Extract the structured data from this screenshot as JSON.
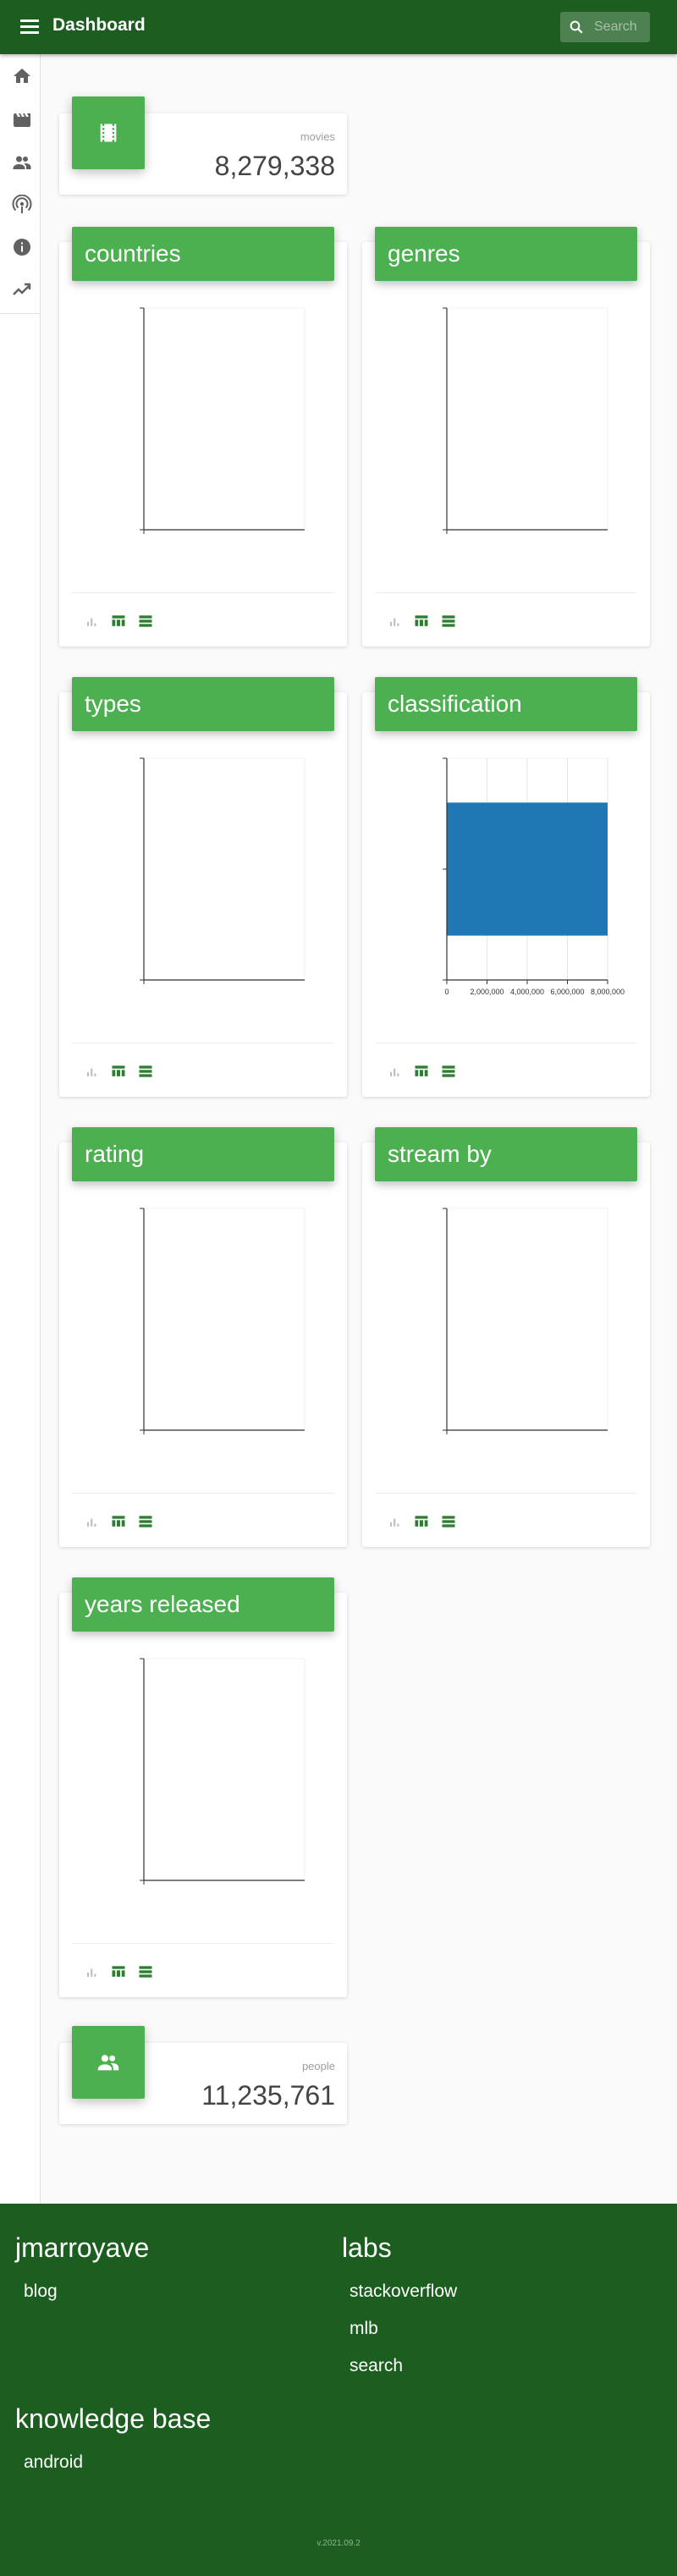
{
  "header": {
    "title": "Dashboard",
    "search_placeholder": "Search"
  },
  "sidebar": {
    "items": [
      "home-icon",
      "movie-icon",
      "people-icon",
      "podcast-icon",
      "info-icon",
      "trending-icon"
    ]
  },
  "stats": {
    "movies": {
      "label": "movies",
      "value": "8,279,338"
    },
    "people": {
      "label": "people",
      "value": "11,235,761"
    }
  },
  "cards": {
    "countries": {
      "title": "countries"
    },
    "genres": {
      "title": "genres"
    },
    "types": {
      "title": "types"
    },
    "classification": {
      "title": "classification"
    },
    "rating": {
      "title": "rating"
    },
    "stream_by": {
      "title": "stream by"
    },
    "years_released": {
      "title": "years released"
    }
  },
  "card_actions": [
    "bar-chart-icon",
    "table-icon",
    "list-icon"
  ],
  "chart_data": [
    {
      "chart": "countries",
      "type": "bar",
      "values": []
    },
    {
      "chart": "genres",
      "type": "bar",
      "values": []
    },
    {
      "chart": "types",
      "type": "bar",
      "values": []
    },
    {
      "chart": "classification",
      "type": "bar",
      "orientation": "horizontal",
      "categories": [
        ""
      ],
      "values": [
        8279338
      ],
      "xlim": [
        0,
        8000000
      ],
      "xticks": [
        0,
        2000000,
        4000000,
        6000000,
        8000000
      ],
      "xtick_labels": [
        "0",
        "2,000,000",
        "4,000,000",
        "6,000,000",
        "8,000,000"
      ],
      "bar_color": "#1f77b4",
      "grid": true
    },
    {
      "chart": "rating",
      "type": "bar",
      "values": []
    },
    {
      "chart": "stream_by",
      "type": "bar",
      "values": []
    },
    {
      "chart": "years_released",
      "type": "bar",
      "values": []
    }
  ],
  "footer": {
    "col1": {
      "heading": "jmarroyave",
      "links": [
        "blog"
      ]
    },
    "col2": {
      "heading": "labs",
      "links": [
        "stackoverflow",
        "mlb",
        "search"
      ]
    },
    "col3": {
      "heading": "knowledge base",
      "links": [
        "android"
      ]
    },
    "version": "v.2021.09.2"
  },
  "colors": {
    "header_bg": "#1b5e20",
    "accent": "#4caf50",
    "footer_bg": "#1b5e20",
    "bar": "#1f77b4"
  }
}
